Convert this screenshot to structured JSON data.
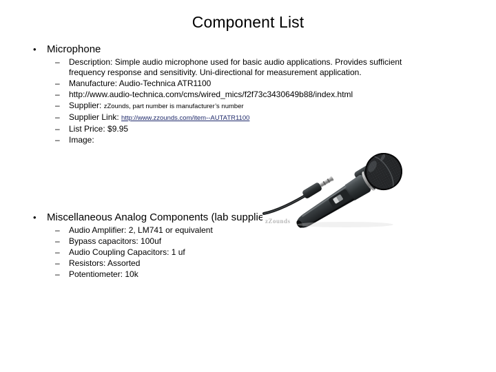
{
  "slide": {
    "title": "Component List",
    "bullets": [
      {
        "label": "Microphone",
        "marker": "•",
        "items": [
          {
            "marker": "–",
            "text": "Description: Simple audio microphone used for basic audio applications. Provides sufficient frequency response and sensitivity. Uni-directional for measurement application."
          },
          {
            "marker": "–",
            "text": "Manufacture: Audio-Technica ATR1100"
          },
          {
            "marker": "–",
            "text": "http://www.audio-technica.com/cms/wired_mics/f2f73c3430649b88/index.html"
          },
          {
            "marker": "–",
            "label": "Supplier: ",
            "note": "zZounds, part number is manufacturer’s number"
          },
          {
            "marker": "–",
            "label": "Supplier Link: ",
            "link": "http://www.zzounds.com/item--AUTATR1100"
          },
          {
            "marker": "–",
            "text": "List Price: $9.95"
          },
          {
            "marker": "–",
            "text": "Image:"
          }
        ]
      },
      {
        "label": "Miscellaneous Analog Components (lab supplies)",
        "marker": "•",
        "items": [
          {
            "marker": "–",
            "text": "Audio Amplifier: 2, LM741 or equivalent"
          },
          {
            "marker": "–",
            "text": "Bypass capacitors: 100uf"
          },
          {
            "marker": "–",
            "text": "Audio Coupling Capacitors:  1 uf"
          },
          {
            "marker": "–",
            "text": "Resistors: Assorted"
          },
          {
            "marker": "–",
            "text": "Potentiometer: 10k"
          }
        ]
      }
    ],
    "image": {
      "alt": "Audio-Technica ATR1100 handheld microphone with cable, 1/4 inch plug and adapter",
      "watermark": "zZounds"
    },
    "colors": {
      "link": "#1f2a6b",
      "text": "#000000",
      "background": "#ffffff",
      "watermark": "#b9b9b9"
    }
  }
}
